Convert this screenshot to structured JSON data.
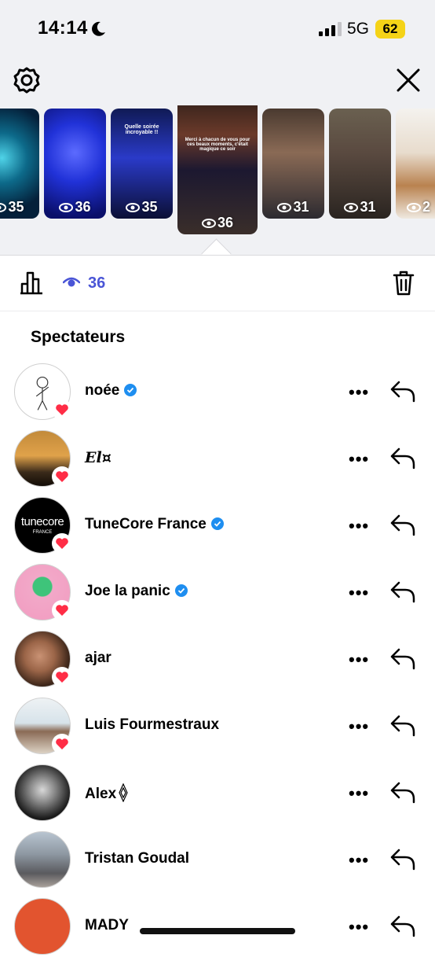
{
  "status": {
    "time": "14:14",
    "network": "5G",
    "battery": "62"
  },
  "stories": [
    {
      "views": "35",
      "caption": ""
    },
    {
      "views": "36",
      "caption": ""
    },
    {
      "views": "35",
      "caption": "Quelle soirée incroyable !!"
    },
    {
      "views": "36",
      "caption": "Merci à chacun de vous pour ces beaux moments, c'était magique ce soir"
    },
    {
      "views": "31",
      "caption": ""
    },
    {
      "views": "31",
      "caption": ""
    },
    {
      "views": "2",
      "caption": ""
    }
  ],
  "toolbar": {
    "view_count": "36"
  },
  "section_title": "Spectateurs",
  "viewers": [
    {
      "name": "noée",
      "verified": true,
      "liked": true
    },
    {
      "name": "El¤",
      "verified": false,
      "liked": true
    },
    {
      "name": "TuneCore France",
      "verified": true,
      "liked": true
    },
    {
      "name": "Joe la panic",
      "verified": true,
      "liked": true
    },
    {
      "name": "ajar",
      "verified": false,
      "liked": true
    },
    {
      "name": "Luis Fourmestraux",
      "verified": false,
      "liked": true
    },
    {
      "name": "Alex",
      "verified": false,
      "liked": false
    },
    {
      "name": "Tristan Goudal",
      "verified": false,
      "liked": false
    },
    {
      "name": "MADY",
      "verified": false,
      "liked": false
    }
  ],
  "avatar_texts": {
    "tunecore_logo": "tunecore",
    "tunecore_sub": "FRANCE"
  },
  "colors": {
    "accent": "#4a55d6",
    "like": "#ff2d46",
    "verified": "#1e8ef0",
    "battery": "#f5d317"
  }
}
